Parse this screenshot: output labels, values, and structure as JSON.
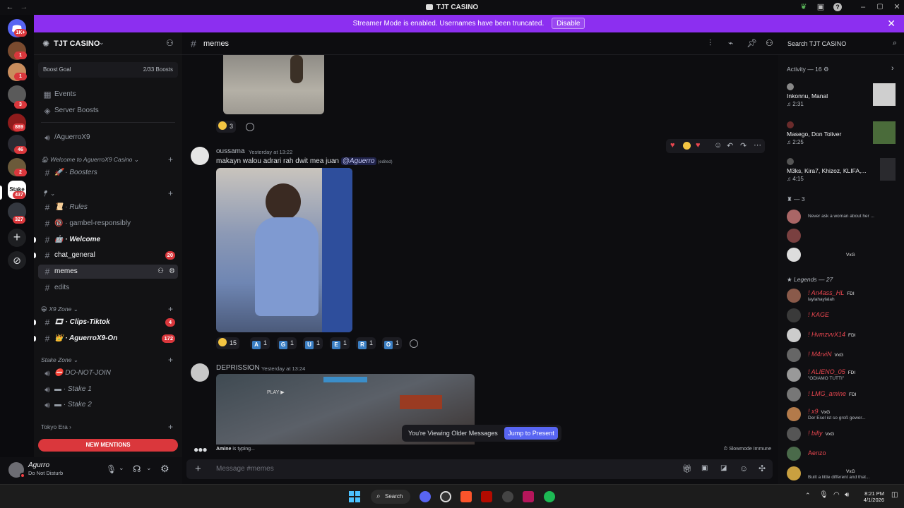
{
  "window": {
    "title": "TJT CASINO"
  },
  "banner": {
    "text": "Streamer Mode is enabled. Usernames have been truncated.",
    "button": "Disable"
  },
  "rail": {
    "badges": [
      "1K+",
      "1",
      "1",
      "3",
      "889",
      "46",
      "2",
      "437",
      "327"
    ]
  },
  "server": {
    "name": "TJT CASINO",
    "boost_goal": "Boost Goal",
    "boost_count": "2/33 Boosts",
    "items": [
      {
        "label": "Events"
      },
      {
        "label": "Server Boosts"
      },
      {
        "label": "/AguerroX9"
      }
    ],
    "categories": [
      {
        "label": "Welcome to AguerroX9 Casino"
      },
      {
        "label": "X9 Zone"
      },
      {
        "label": "Stake Zone"
      },
      {
        "label": "Tokyo Era"
      }
    ],
    "channels": {
      "boosters": "Boosters",
      "rules": "Rules",
      "gambel": "gambel-responsibly",
      "welcome": "Welcome",
      "chat_general": "chat_general",
      "chat_general_count": "20",
      "memes": "memes",
      "edits": "edits",
      "clips": "Clips-Tiktok",
      "clips_count": "4",
      "aguerro_on": "AguerroX9-On",
      "aguerro_on_count": "172",
      "donotjoin": "DO-NOT-JOIN",
      "stake1": "Stake 1",
      "stake2": "Stake 2"
    },
    "new_mentions": "NEW MENTIONS"
  },
  "user": {
    "name": "Agurro",
    "status": "Do Not Disturb"
  },
  "channel": {
    "name": "memes",
    "search_placeholder": "Search TJT CASINO"
  },
  "messages": [
    {
      "reaction_count": "3"
    },
    {
      "author": "oussama",
      "timestamp": "Yesterday at 13:22",
      "text": "makayn walou adrari rah dwit mea juan",
      "mention": "@Aguerro",
      "edited": "(edited)",
      "reactions": [
        {
          "label": "",
          "count": "15"
        },
        {
          "label": "A",
          "count": "1"
        },
        {
          "label": "G",
          "count": "1"
        },
        {
          "label": "U",
          "count": "1"
        },
        {
          "label": "E",
          "count": "1"
        },
        {
          "label": "R",
          "count": "1"
        },
        {
          "label": "O",
          "count": "1"
        }
      ]
    },
    {
      "author": "DEPRISSION",
      "timestamp": "Yesterday at 13:24",
      "embed_text": "PLAY ▶"
    }
  ],
  "older_messages": {
    "text": "You're Viewing Older Messages",
    "button": "Jump to Present"
  },
  "typing": {
    "name": "Amine",
    "text": "is typing..."
  },
  "slowmode": "Slowmode Immune",
  "composer": {
    "placeholder": "Message #memes"
  },
  "activity": {
    "title": "Activity — 16",
    "items": [
      {
        "name": "Inkonnu, Manal",
        "time": "♫ 2:31"
      },
      {
        "name": "Masego, Don Toliver",
        "time": "♫ 2:25"
      },
      {
        "name": "M3ks, Kira7, Khizoz, KLIFA,...",
        "time": "♫ 4:15"
      }
    ],
    "group1": "— 3",
    "group1_members": [
      {
        "status": "Never ask a woman about her ..."
      },
      {
        "status": ""
      },
      {
        "tag": "VxG"
      }
    ],
    "group2": "Legends — 27",
    "members": [
      {
        "name": "! An4ass_HL",
        "tag": "FDI",
        "status": "laylahaylalah"
      },
      {
        "name": "! KAGE",
        "tag": "",
        "status": ""
      },
      {
        "name": "! HvmzvvX14",
        "tag": "FDI",
        "status": ""
      },
      {
        "name": "! M4rviN",
        "tag": "VxG",
        "status": ""
      },
      {
        "name": "! ALIENO_05",
        "tag": "FDI",
        "status": "\"ODIAMO TUTTI\""
      },
      {
        "name": "! LMG_amine",
        "tag": "FDI",
        "status": ""
      },
      {
        "name": "! x9",
        "tag": "VxG",
        "status": "Der Esel ist so groß gewor..."
      },
      {
        "name": "! billy",
        "tag": "VxG",
        "status": ""
      },
      {
        "name": "Aenzo",
        "tag": "",
        "status": ""
      },
      {
        "name": "",
        "tag": "VxG",
        "status": "Built a little different and that..."
      }
    ]
  },
  "taskbar": {
    "search": "Search",
    "time": "8:21 PM",
    "date": "4/1/2026"
  }
}
